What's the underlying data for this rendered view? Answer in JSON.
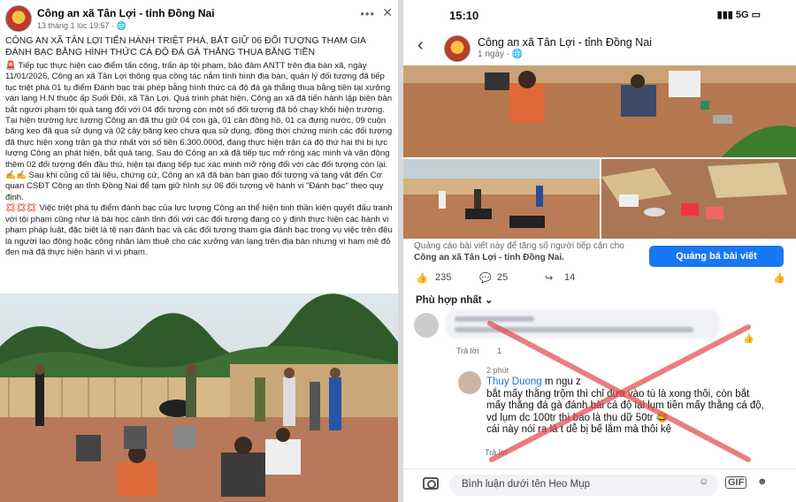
{
  "left_post": {
    "page_name": "Công an xã Tân Lợi - tỉnh Đồng Nai",
    "time": "13 tháng 1 lúc 19:57 · 🌐",
    "title": "CÔNG AN XÃ TÂN LỢI TIẾN HÀNH TRIỆT PHÁ, BẮT GIỮ 06 ĐỐI TƯỢNG THAM GIA ĐÁNH BẠC BẰNG HÌNH THỨC CÁ ĐỘ ĐÁ GÀ THẮNG THUA BẰNG TIỀN",
    "para1": "🚨 Tiếp tục thực hiện cao điểm tấn công, trấn áp tội phạm, bảo đảm ANTT trên địa bàn xã, ngày 11/01/2026, Công an xã Tân Lợi thông qua công tác nắm tình hình địa bàn, quản lý đối tượng đã tiếp tục triệt phá 01 tụ điểm Đánh bạc trái phép bằng hình thức cá độ đá gà thắng thua bằng tiền tại xưởng ván lạng H.N thuộc ấp Suối Đôi, xã Tân Lợi. Quá trình phát hiện, Công an xã đã tiến hành lập biên bản bắt người phạm tội quả tang đối với 04 đối tượng còn một số đối tượng đã bỏ chạy khỏi hiện trường. Tại hiện trường lực lượng Công an đã thu giữ 04 con gà, 01 cân đồng hồ, 01 ca đựng nước, 09 cuộn băng keo đã qua sử dụng và 02 cây băng keo chưa qua sử dụng, đồng thời chứng minh các đối tượng đã thực hiện xong trận gà thứ nhất với số tiền 6.300.000đ, đang thực hiện trận cá độ thứ hai thì bị lực lượng Công an phát hiện, bắt quả tang. Sau đó Công an xã đã tiếp tục mở rộng xác minh và vận động thêm 02 đối tượng đến đầu thú, hiện tại đang tiếp tục xác minh mở rộng đối với các đối tượng còn lại.",
    "para2": "✍️✍️ Sau khi củng cố tài liệu, chứng cứ, Công an xã đã bàn bàn giao đối tượng và tang vật đến Cơ quan CSĐT Công an tỉnh Đồng Nai để tạm giữ hình sự 06 đối tượng về hành vi \"Đánh bạc\" theo quy định.",
    "para3": "💢💢💢 Việc triệt phá tụ điểm đánh bạc của lực lượng Công an thể hiện tinh thần kiên quyết đấu tranh với tội phạm cũng như là bài học cảnh tỉnh đối với các đối tượng đang có ý định thực hiện các hành vi phạm pháp luật, đặc biệt là tệ nạn đánh bạc và các đối tượng tham gia đánh bạc trong vụ việc trên đều là người lao động hoặc công nhân làm thuê cho các xưởng ván lạng trên địa bàn nhưng vì ham mê đỏ đen mà đã thực hiện hành vi vi phạm."
  },
  "phone": {
    "status_time": "15:10",
    "status_right": "5G",
    "page_name": "Công an xã Tân Lợi - tỉnh Đồng Nai",
    "post_time": "1 ngày · 🌐",
    "promo_text": "Quảng cáo bài viết này để tăng số người tiếp cận cho",
    "promo_page": "Công an xã Tân Lợi - tỉnh Đồng Nai.",
    "promo_button": "Quảng bá bài viết",
    "likes": "235",
    "comments": "25",
    "shares": "14",
    "sort_label": "Phù hợp nhất",
    "reply_like": "Trả lời",
    "reply_time": "2 phút",
    "reply_author": "Thuy Duong",
    "reply_text1": " m ngu z",
    "reply_text2": "bắt mấy thằng trộm thì chỉ đưa vào tù là xong thôi, còn bắt mấy thằng đá gà đánh bài cá độ lại lụm tiền mấy thằng cá độ, vd lụm dc 100tr thì báo là thu dữ 50tr 😂",
    "reply_text3": "cái này nói ra là t dễ bị bế lắm mà thôi kệ",
    "count_1": "1",
    "input_placeholder": "Bình luận dưới tên Heo Mụp",
    "gif": "GIF",
    "accent": "#1877f2",
    "red_x": "#e04848"
  }
}
